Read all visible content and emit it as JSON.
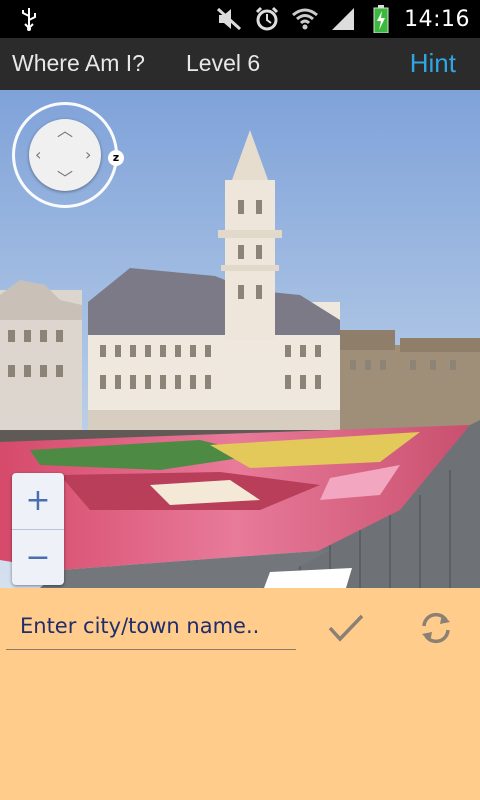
{
  "status_bar": {
    "time": "14:16",
    "icons": [
      "usb-icon",
      "mute-icon",
      "alarm-icon",
      "wifi-icon",
      "signal-icon",
      "battery-charging-icon"
    ]
  },
  "title_bar": {
    "app_title": "Where Am I?",
    "level": "Level 6",
    "hint_label": "Hint"
  },
  "street_view": {
    "controls": [
      "pan-control",
      "zoom-in",
      "zoom-out"
    ],
    "zoom_in_label": "+",
    "zoom_out_label": "−",
    "compass_label": "z"
  },
  "answer": {
    "placeholder": "Enter city/town name..",
    "value": "",
    "submit_icon": "checkmark-icon",
    "refresh_icon": "refresh-icon"
  },
  "colors": {
    "hint": "#2fa6e0",
    "panel": "#ffcc8c",
    "input_text": "#1f2d6b"
  }
}
